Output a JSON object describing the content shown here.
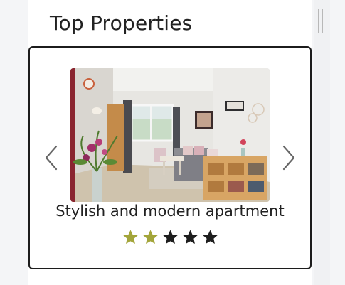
{
  "section": {
    "title": "Top Properties"
  },
  "carousel": {
    "prev_icon": "chevron-left-icon",
    "next_icon": "chevron-right-icon",
    "current": {
      "name": "Stylish and modern apartment",
      "rating": 2,
      "max_rating": 5
    }
  },
  "colors": {
    "star_filled": "#a3a53a",
    "star_empty": "#1e1e1e",
    "card_border": "#1c1c1c"
  }
}
